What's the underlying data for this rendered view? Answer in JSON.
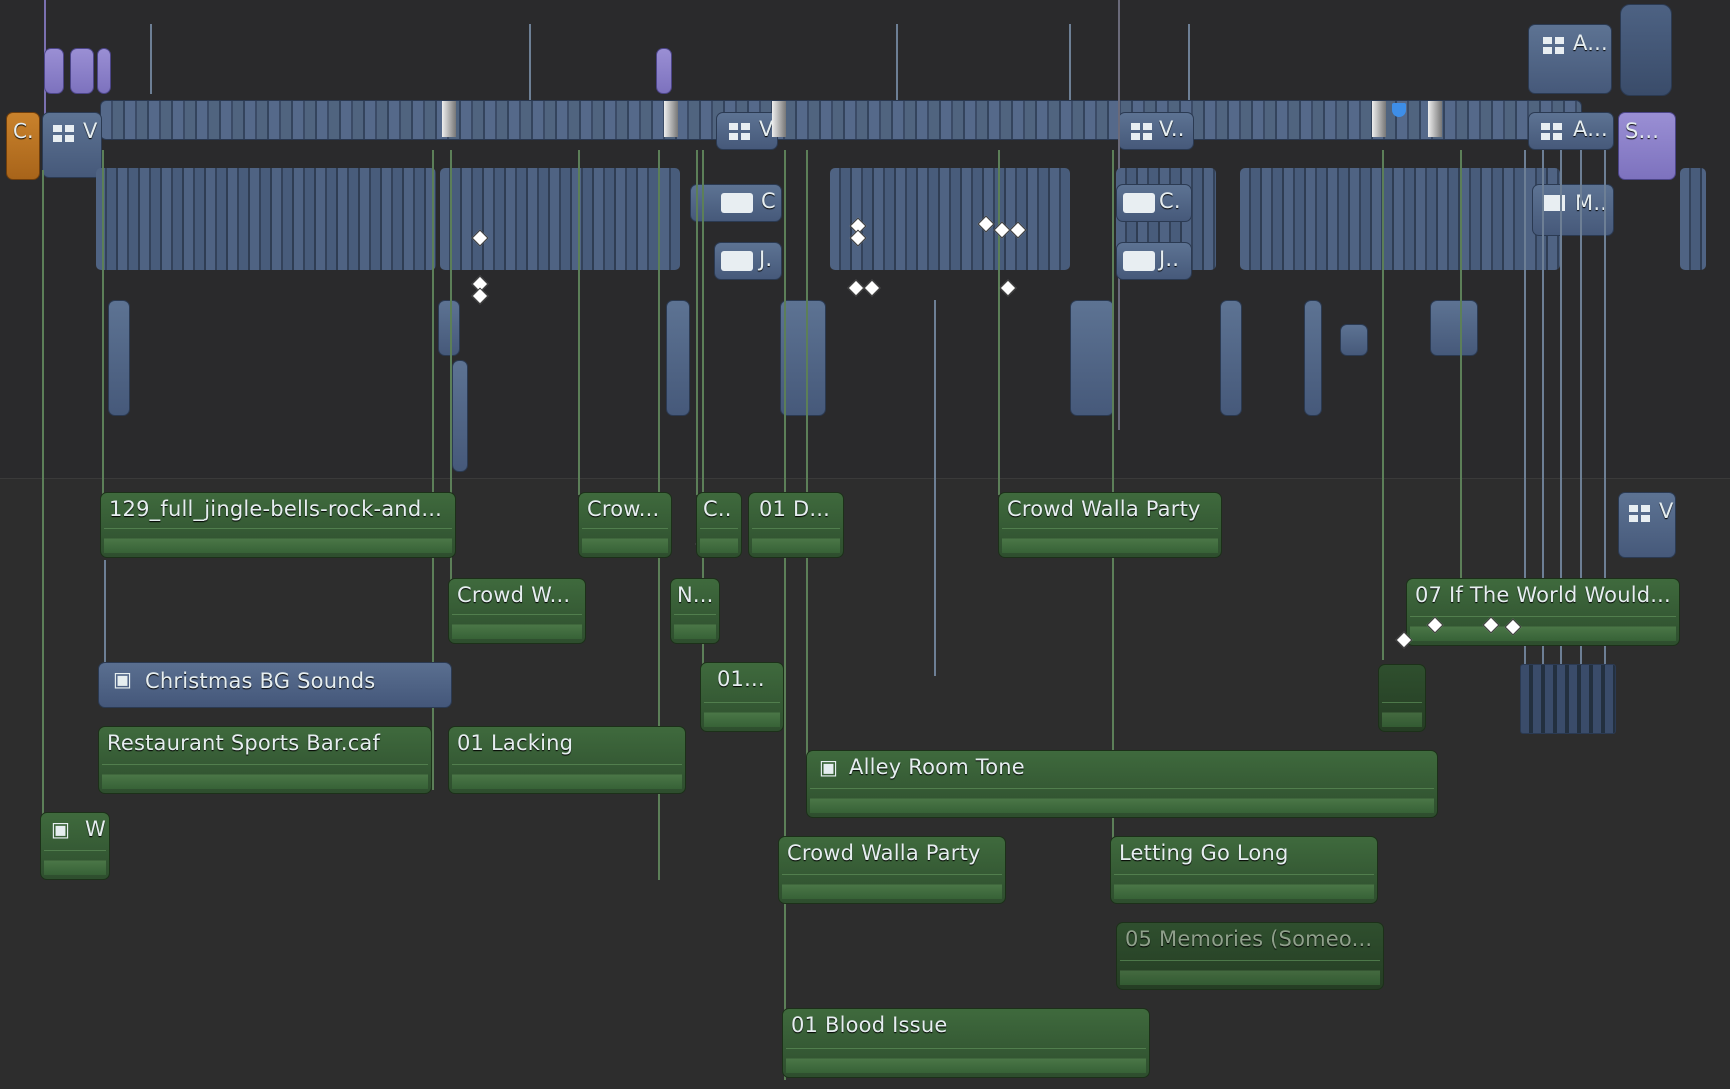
{
  "timeline": {
    "top_clips": {
      "orange_clip": "C.",
      "title_1": "V",
      "title_2": "V",
      "title_3": "V..",
      "title_4": "A...",
      "title_5": "A...",
      "title_6": "S...",
      "title_7": "M..",
      "audio_c1": "C",
      "audio_j1": "J.",
      "audio_c2": "C.",
      "audio_j2": "J.."
    },
    "clips": [
      {
        "name": "129_full_jingle-bells-rock-and..."
      },
      {
        "name": "Crow..."
      },
      {
        "name": "C.."
      },
      {
        "name": "01 D..."
      },
      {
        "name": "Crowd Walla Party"
      },
      {
        "name": "V"
      },
      {
        "name": "Crowd W..."
      },
      {
        "name": "N..."
      },
      {
        "name": "07 If The World Would..."
      },
      {
        "name": "Christmas BG Sounds"
      },
      {
        "name": "01..."
      },
      {
        "name": "Restaurant Sports Bar.caf"
      },
      {
        "name": "01 Lacking"
      },
      {
        "name": "Alley Room Tone"
      },
      {
        "name": "W"
      },
      {
        "name": "Crowd Walla Party"
      },
      {
        "name": "Letting Go Long"
      },
      {
        "name": "05 Memories (Someo..."
      },
      {
        "name": "01 Blood Issue"
      }
    ],
    "colors": {
      "background": "#2b2b2b",
      "video_clip": "#566b8c",
      "audio_clip": "#3f6a3d",
      "title_clip": "#8f84cc",
      "orange_clip": "#c07926",
      "marker": "#3e8ee8"
    }
  }
}
